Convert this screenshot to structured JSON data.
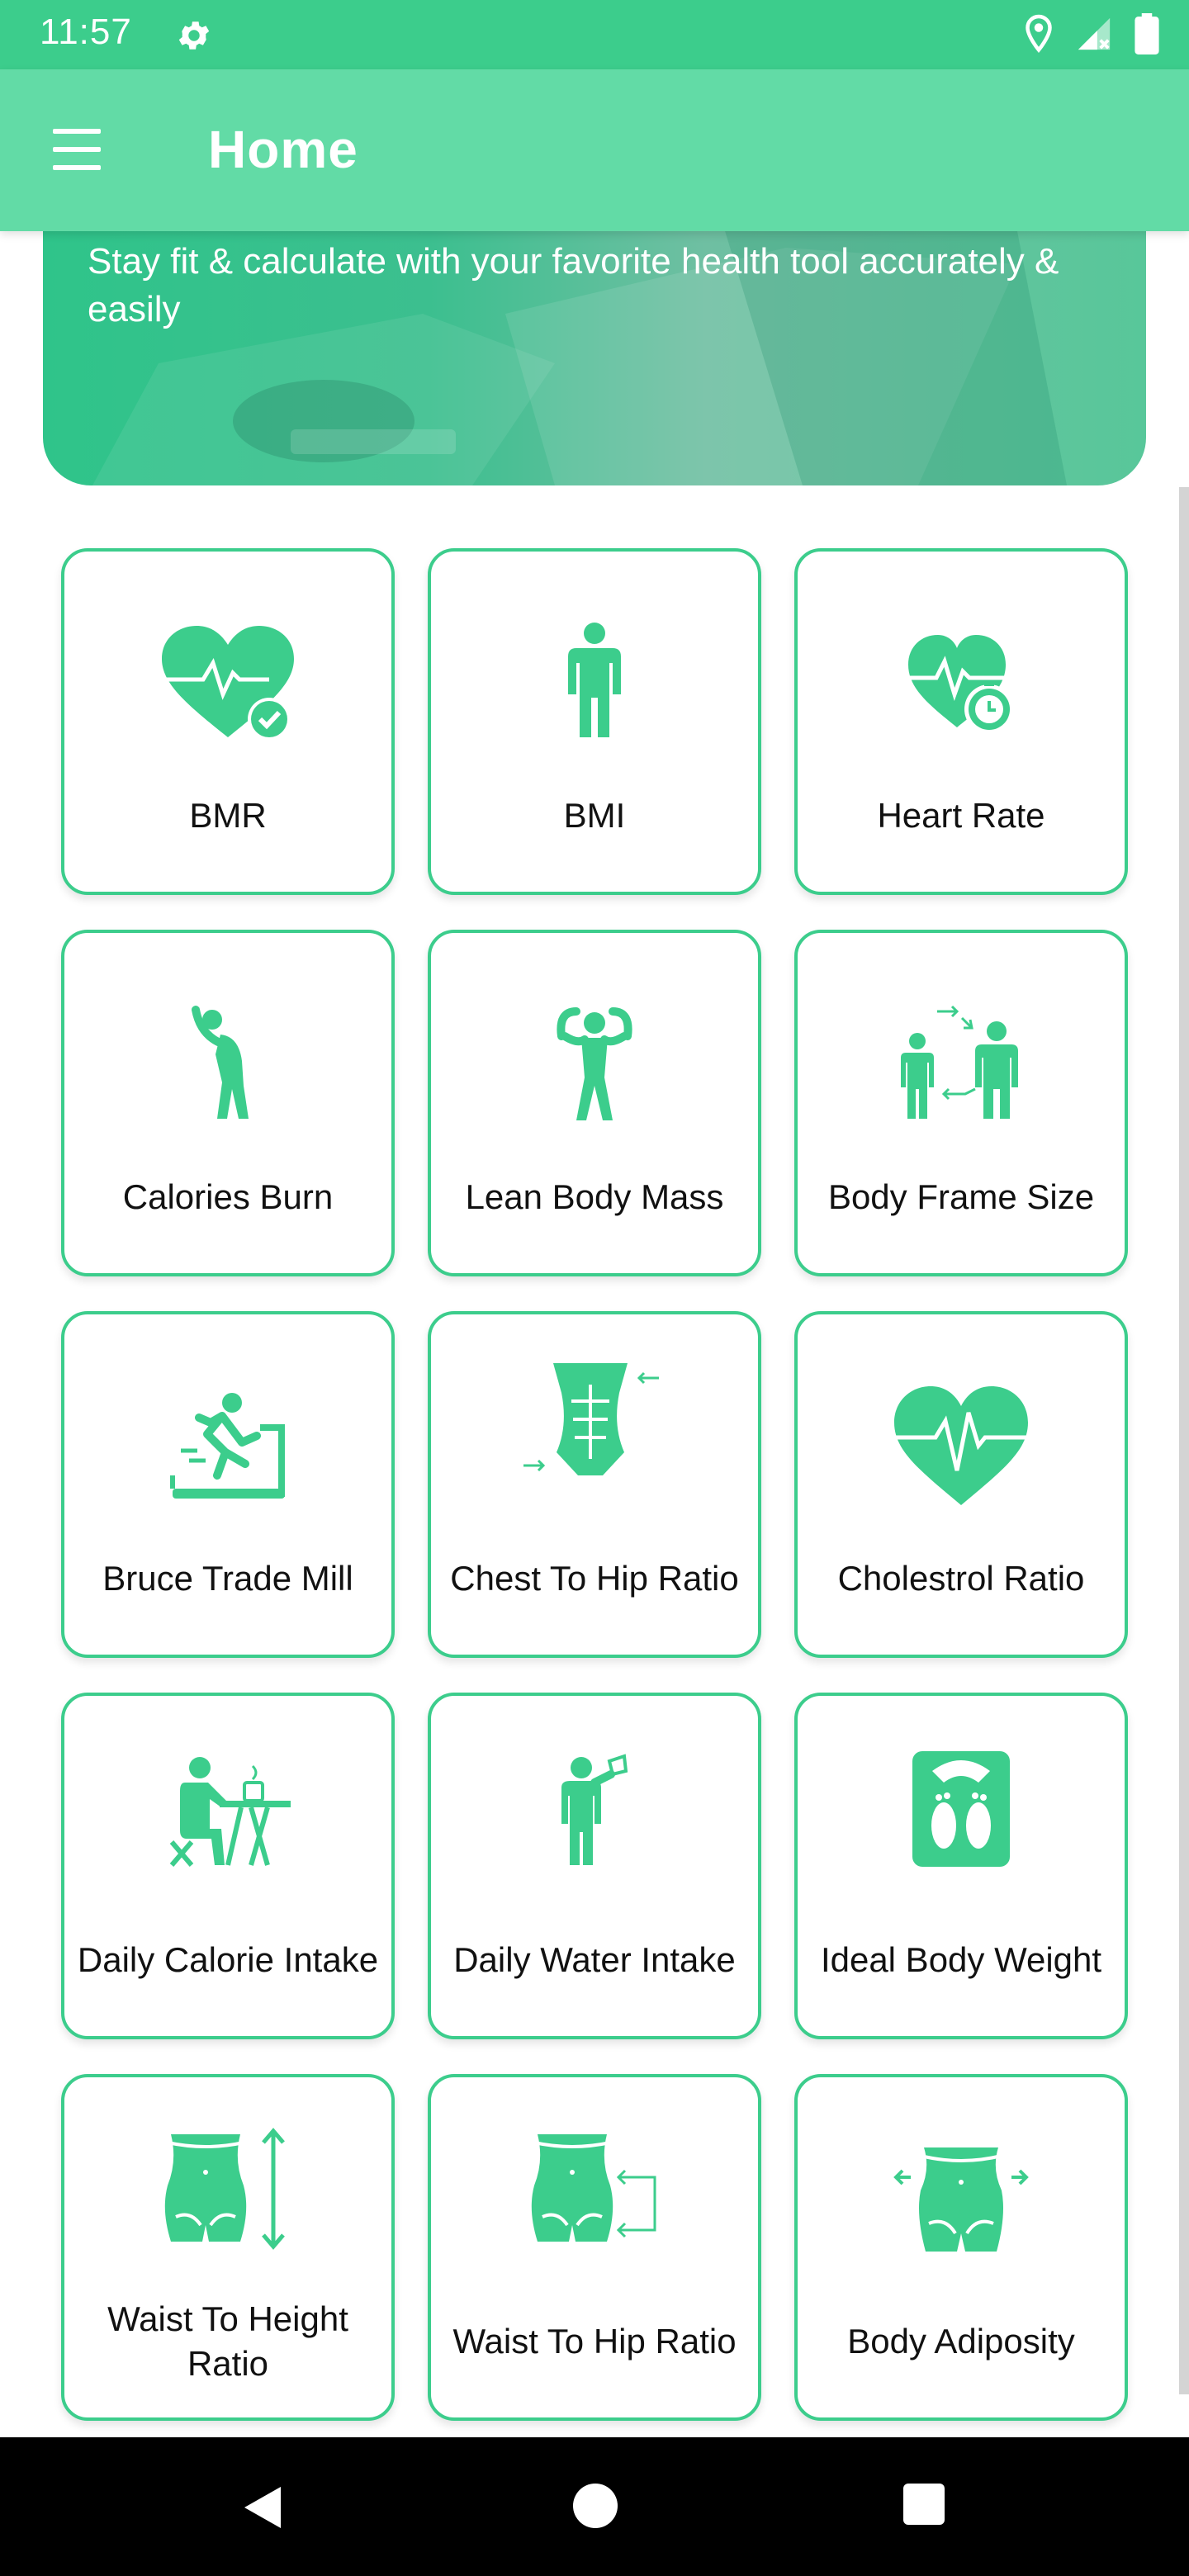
{
  "status_bar": {
    "time": "11:57",
    "icons": [
      "gear-icon",
      "location-icon",
      "signal-icon",
      "battery-icon"
    ]
  },
  "app_bar": {
    "title": "Home",
    "menu_icon": "hamburger-menu-icon"
  },
  "banner": {
    "text": "Stay fit & calculate with your favorite health tool accurately & easily"
  },
  "colors": {
    "status_bar": "#3ccd8c",
    "app_bar": "#62dba6",
    "accent": "#3ccd8c",
    "nav_bar": "#000000"
  },
  "tiles": [
    {
      "label": "BMR",
      "icon": "heart-check-icon"
    },
    {
      "label": "BMI",
      "icon": "person-icon"
    },
    {
      "label": "Heart Rate",
      "icon": "heart-timer-icon"
    },
    {
      "label": "Calories Burn",
      "icon": "stretching-person-icon"
    },
    {
      "label": "Lean Body Mass",
      "icon": "flexing-person-icon"
    },
    {
      "label": "Body Frame Size",
      "icon": "two-persons-compare-icon"
    },
    {
      "label": "Bruce Trade Mill",
      "icon": "treadmill-runner-icon"
    },
    {
      "label": "Chest To Hip Ratio",
      "icon": "torso-abs-icon"
    },
    {
      "label": "Cholestrol Ratio",
      "icon": "heart-pulse-icon"
    },
    {
      "label": "Daily Calorie Intake",
      "icon": "person-eating-icon"
    },
    {
      "label": "Daily Water Intake",
      "icon": "person-drinking-icon"
    },
    {
      "label": "Ideal Body Weight",
      "icon": "weight-scale-icon"
    },
    {
      "label": "Waist To Height Ratio",
      "icon": "waist-height-icon"
    },
    {
      "label": "Waist To Hip Ratio",
      "icon": "waist-hip-icon"
    },
    {
      "label": "Body Adiposity",
      "icon": "waist-width-icon"
    }
  ],
  "nav_bar": {
    "icons": [
      "back-icon",
      "home-icon",
      "recents-icon"
    ]
  }
}
